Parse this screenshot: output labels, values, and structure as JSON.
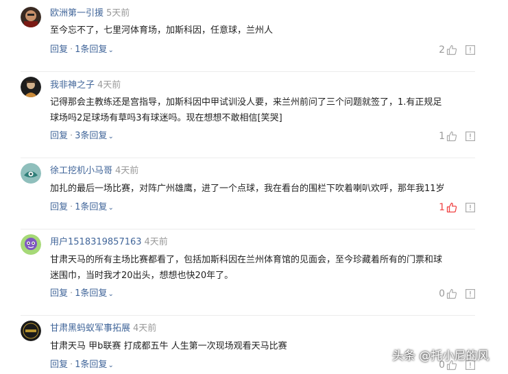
{
  "comments": [
    {
      "user": "欧洲第一引援",
      "time": "5天前",
      "text_lines": [
        "至今忘不了，七里河体育场，加斯科因，任意球，兰州人"
      ],
      "reply_label": "回复",
      "sep": "·",
      "replies_label": "1条回复",
      "likes": "2",
      "liked": false
    },
    {
      "user": "我非神之子",
      "time": "4天前",
      "text_lines": [
        "记得那会主教练还是宫指导，加斯科因中甲试训没人要，来兰州前问了三个问题就签了，1.有正规足",
        "球场吗2足球场有草吗3有球迷吗。现在想想不敢相信[笑哭]"
      ],
      "reply_label": "回复",
      "sep": "·",
      "replies_label": "3条回复",
      "likes": "1",
      "liked": false
    },
    {
      "user": "徐工挖机小马哥",
      "time": "4天前",
      "text_lines": [
        "加扎的最后一场比赛，对阵广州雄鹰，进了一个点球，我在看台的围栏下吹着喇叭欢呼，那年我11岁"
      ],
      "reply_label": "回复",
      "sep": "·",
      "replies_label": "1条回复",
      "likes": "1",
      "liked": true
    },
    {
      "user": "用户1518319857163",
      "time": "4天前",
      "text_lines": [
        "甘肃天马的所有主场比赛都看了，包括加斯科因在兰州体育馆的见面会，至今珍藏着所有的门票和球",
        "迷围巾，当时我才20出头，想想也快20年了。"
      ],
      "reply_label": "回复",
      "sep": "·",
      "replies_label": "1条回复",
      "likes": "0",
      "liked": false
    },
    {
      "user": "甘肃黑蚂蚁军事拓展",
      "time": "4天前",
      "text_lines": [
        "甘肃天马 甲b联赛 打成都五牛 人生第一次现场观看天马比赛"
      ],
      "reply_label": "回复",
      "sep": "·",
      "replies_label": "1条回复",
      "likes": "0",
      "liked": false
    }
  ],
  "watermark": {
    "source": "头条",
    "at": "@",
    "author": "托小尼的风"
  },
  "colors": {
    "username": "#406599",
    "muted": "#999999",
    "liked": "#f04142",
    "divider": "#ececec"
  }
}
